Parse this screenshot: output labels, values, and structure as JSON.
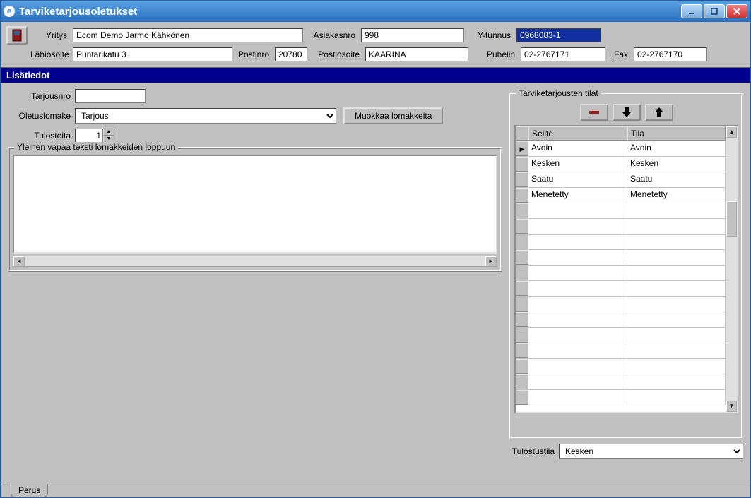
{
  "window": {
    "title": "Tarviketarjousoletukset"
  },
  "header": {
    "labels": {
      "yritys": "Yritys",
      "asiakasnro": "Asiakasnro",
      "ytunnus": "Y-tunnus",
      "lahiosoite": "Lähiosoite",
      "postinro": "Postinro",
      "postiosoite": "Postiosoite",
      "puhelin": "Puhelin",
      "fax": "Fax"
    },
    "values": {
      "yritys": "Ecom Demo Jarmo Kähkönen",
      "asiakasnro": "998",
      "ytunnus": "0968083-1",
      "lahiosoite": "Puntarikatu 3",
      "postinro": "20780",
      "postiosoite": "KAARINA",
      "puhelin": "02-2767171",
      "fax": "02-2767170"
    }
  },
  "section": {
    "title": "Lisätiedot"
  },
  "form": {
    "labels": {
      "tarjousnro": "Tarjousnro",
      "oletuslomake": "Oletuslomake",
      "tulosteita": "Tulosteita",
      "muokkaa": "Muokkaa lomakkeita",
      "vapaa_teksti_legend": "Yleinen vapaa teksti lomakkeiden loppuun"
    },
    "values": {
      "tarjousnro": "",
      "oletuslomake": "Tarjous",
      "tulosteita": "1",
      "vapaa_teksti": ""
    }
  },
  "tilat": {
    "legend": "Tarviketarjousten tilat",
    "columns": {
      "selite": "Selite",
      "tila": "Tila"
    },
    "rows": [
      {
        "selite": "Avoin",
        "tila": "Avoin"
      },
      {
        "selite": "Kesken",
        "tila": "Kesken"
      },
      {
        "selite": "Saatu",
        "tila": "Saatu"
      },
      {
        "selite": "Menetetty",
        "tila": "Menetetty"
      }
    ],
    "tulostustila_label": "Tulostustila",
    "tulostustila_value": "Kesken"
  },
  "tab": {
    "label": "Perus"
  }
}
